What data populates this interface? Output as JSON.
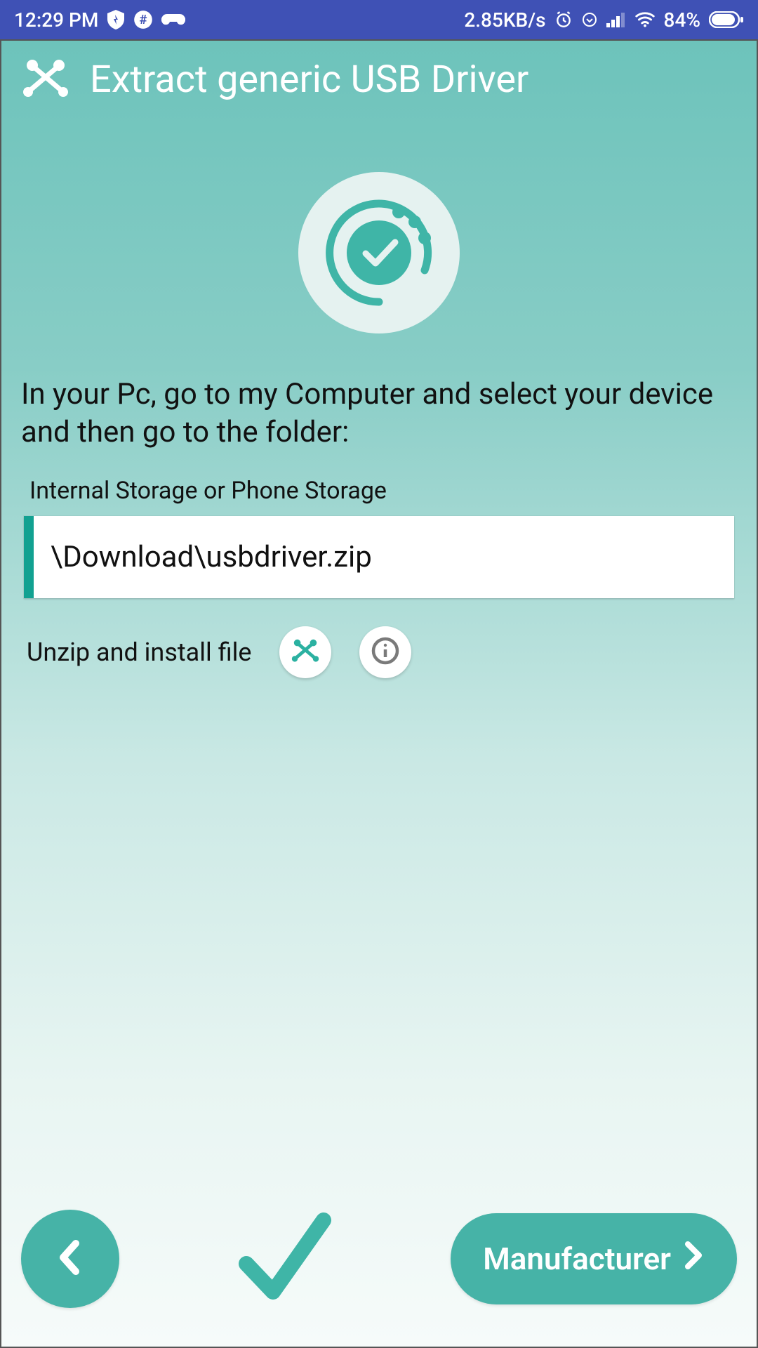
{
  "status": {
    "time": "12:29 PM",
    "net_speed": "2.85KB/s",
    "battery": "84%"
  },
  "header": {
    "title": "Extract generic USB Driver"
  },
  "main": {
    "instruction": "In your Pc, go to my Computer and select your device and then go to the folder:",
    "storage_label": "Internal Storage or Phone Storage",
    "path": "\\Download\\usbdriver.zip",
    "unzip_label": "Unzip and install file"
  },
  "nav": {
    "next_label": "Manufacturer"
  }
}
